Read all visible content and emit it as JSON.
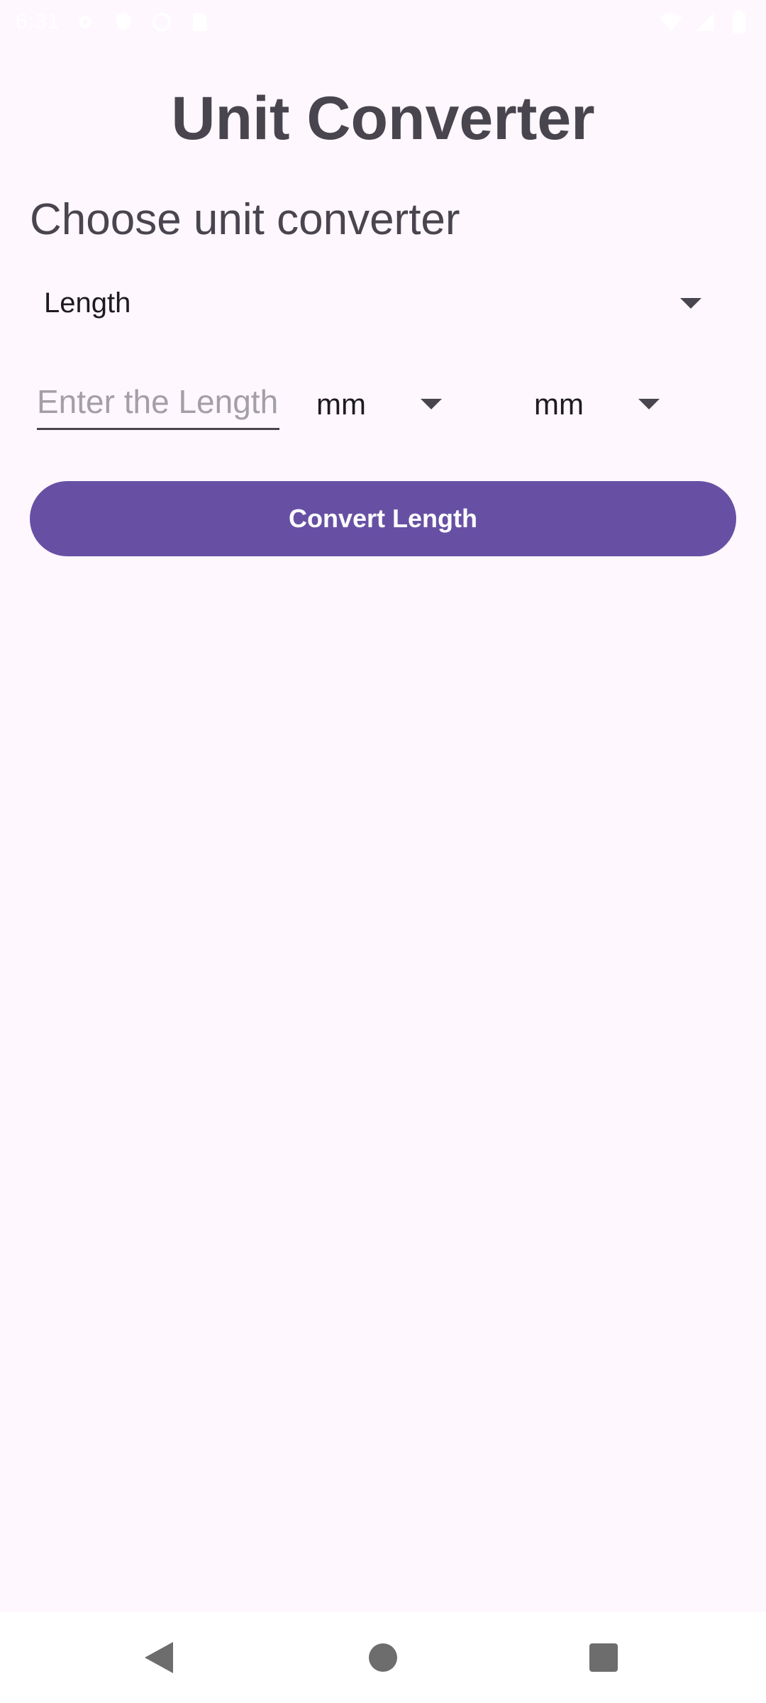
{
  "status_bar": {
    "time": "6:31",
    "icons": [
      "settings-icon",
      "shield-icon",
      "sync-icon",
      "sim-card-icon",
      "wifi-icon",
      "signal-icon",
      "battery-icon"
    ]
  },
  "app": {
    "title": "Unit Converter",
    "section_label": "Choose unit converter"
  },
  "category_spinner": {
    "selected": "Length"
  },
  "length_input": {
    "value": "",
    "placeholder": "Enter the Length"
  },
  "from_unit": {
    "selected": "mm"
  },
  "to_unit": {
    "selected": "mm"
  },
  "convert_button": {
    "label": "Convert Length"
  },
  "colors": {
    "background": "#fef7fd",
    "accent": "#6750a4",
    "title_text": "#49454f"
  },
  "nav_bar": {
    "icons": [
      "back-icon",
      "home-icon",
      "recents-icon"
    ]
  }
}
